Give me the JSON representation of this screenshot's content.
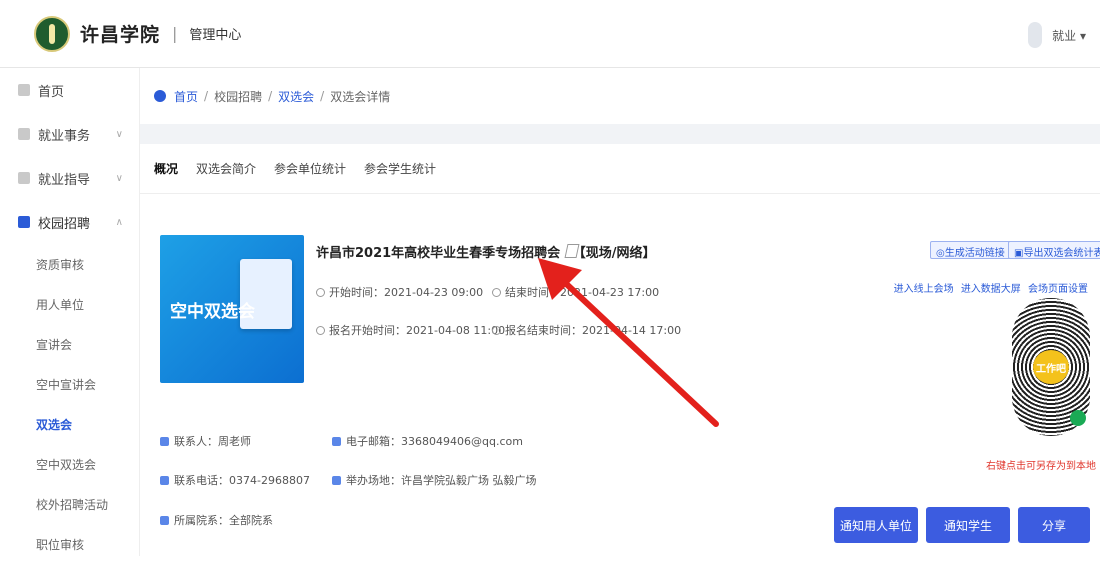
{
  "header": {
    "school_name": "许昌学院",
    "separator": "|",
    "section": "管理中心",
    "user_label": "就业 ▾"
  },
  "sidebar": {
    "items": [
      {
        "label": "首页",
        "chevron": ""
      },
      {
        "label": "就业事务",
        "chevron": "∨"
      },
      {
        "label": "就业指导",
        "chevron": "∨"
      },
      {
        "label": "校园招聘",
        "chevron": "∧"
      }
    ],
    "subitems": [
      "资质审核",
      "用人单位",
      "宣讲会",
      "空中宣讲会",
      "双选会",
      "空中双选会",
      "校外招聘活动",
      "职位审核"
    ]
  },
  "breadcrumb": {
    "home": "首页",
    "c1": "校园招聘",
    "c2": "双选会",
    "c3": "双选会详情",
    "sep": "/"
  },
  "tabs": [
    "概况",
    "双选会简介",
    "参会单位统计",
    "参会学生统计"
  ],
  "event": {
    "banner_text": "空中双选会",
    "title": "许昌市2021年高校毕业生春季专场招聘会",
    "mode": "【现场/网络】",
    "start": "开始时间：2021-04-23 09:00",
    "end": "结束时间：2021-04-23 17:00",
    "reg_start": "报名开始时间：2021-04-08 11:00",
    "reg_end": "报名结束时间：2021-04-14 17:00"
  },
  "actions": {
    "generate_link": "◎生成活动链接",
    "export_stats": "▣导出双选会统计表",
    "link1": "进入线上会场",
    "link2": "进入数据大屏",
    "link3": "会场页面设置",
    "qr_center": "工作吧",
    "qr_note": "右键点击可另存为到本地"
  },
  "contact": {
    "person": "联系人：周老师",
    "email": "电子邮箱：3368049406@qq.com",
    "phone": "联系电话：0374-2968807",
    "venue": "举办场地：许昌学院弘毅广场 弘毅广场",
    "dept": "所属院系：全部院系"
  },
  "buttons": {
    "notify_employers": "通知用人单位",
    "notify_students": "通知学生",
    "share": "分享"
  },
  "colors": {
    "primary": "#3c5ce0",
    "link": "#2b5bd7",
    "arrow": "#e3211c",
    "note": "#e0352b"
  }
}
